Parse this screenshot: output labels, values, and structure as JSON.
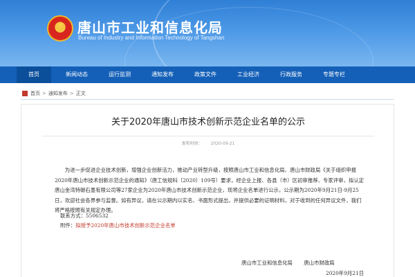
{
  "header": {
    "title": "唐山市工业和信息化局",
    "subtitle": "Bureau of Industry and Information Technology of Tangshan",
    "brand_color": "#1460b8"
  },
  "nav": {
    "items": [
      {
        "label": "首页"
      },
      {
        "label": "新闻动态"
      },
      {
        "label": "运行监测"
      },
      {
        "label": "通知发布"
      },
      {
        "label": "政策文件"
      },
      {
        "label": "工业经济"
      },
      {
        "label": "行政服务"
      },
      {
        "label": "专题专栏"
      }
    ],
    "active_index": 0
  },
  "breadcrumb": {
    "items": [
      "首页",
      "通知发布",
      "正文"
    ]
  },
  "article": {
    "title": "关于2020年唐山市技术创新示范企业名单的公示",
    "meta_prefix": "发布时间：",
    "date": "2020-09-21",
    "body": "为进一步促进企业技术创新，增强企业创新活力，推动产业转型升级，按照唐山市工业和信息化局、唐山市财政局《关于组织申报2020年唐山市技术创新示范企业的通知》（唐工信规科〔2020〕109号）要求，经企业上报、各县（市）区初审推荐、专家评审，拟认定唐山金湾特碳石墨有限公司等27家企业为2020年唐山市技术创新示范企业，现将企业名单进行公示，公示期为2020年9月21日-9月25日，欢迎社会各界参与监督。如有异议，请在公示期内以实名、书面形式提出，并提供必要的证明材料，对于收到的任何异议文件，我们将严格按照有关规定办理。",
    "contact": "联系方式：5506532",
    "attachment_label": "附件：",
    "attachment_link": "拟授予2020年唐山市技术创新示范企业名单",
    "signer_1": "唐山市工业和信息化局",
    "signer_2": "唐山市财政局",
    "sign_date": "2020年9月21日"
  }
}
